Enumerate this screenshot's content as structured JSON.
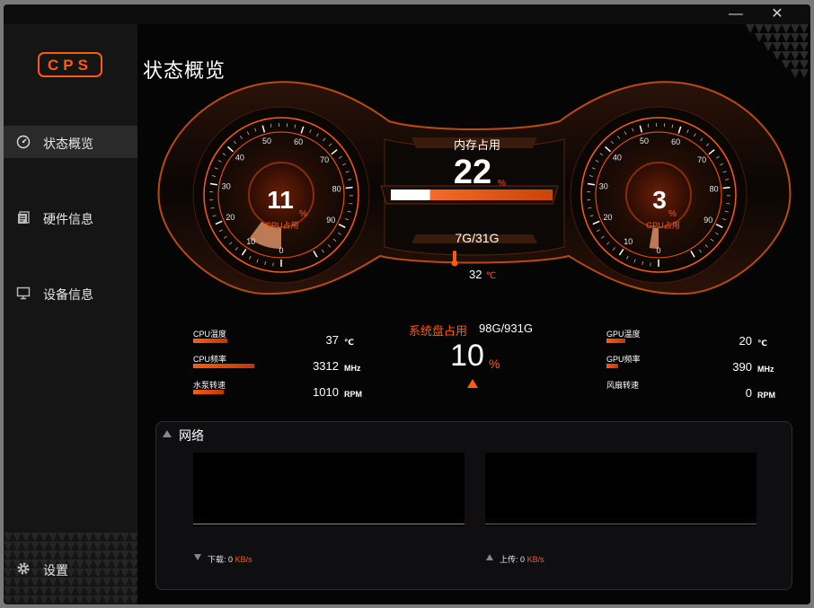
{
  "window": {
    "minimize_glyph": "—",
    "close_glyph": "✕"
  },
  "logo": {
    "text": "CPS"
  },
  "sidebar": {
    "items": [
      {
        "label": "状态概览",
        "icon": "gauge-icon"
      },
      {
        "label": "硬件信息",
        "icon": "document-icon"
      },
      {
        "label": "设备信息",
        "icon": "monitor-icon"
      }
    ],
    "settings_label": "设置"
  },
  "page_title": "状态概览",
  "cpu_gauge": {
    "value": "11",
    "unit": "%",
    "label": "CPU占用",
    "ticks": [
      "0",
      "10",
      "20",
      "30",
      "40",
      "50",
      "60",
      "70",
      "80",
      "90"
    ],
    "percent": 11
  },
  "gpu_gauge": {
    "value": "3",
    "unit": "%",
    "label": "GPU占用",
    "ticks": [
      "0",
      "10",
      "20",
      "30",
      "40",
      "50",
      "60",
      "70",
      "80",
      "90"
    ],
    "percent": 3
  },
  "memory": {
    "title": "内存占用",
    "value": "22",
    "unit": "%",
    "usage": "7G/31G",
    "percent": 22
  },
  "temperature": {
    "value": "32",
    "unit": "℃"
  },
  "cpu_stats": [
    {
      "label": "CPU温度",
      "value": "37",
      "unit": "℃",
      "level": 0.45
    },
    {
      "label": "CPU频率",
      "value": "3312",
      "unit": "MHz",
      "level": 0.8
    },
    {
      "label": "水泵转速",
      "value": "1010",
      "unit": "RPM",
      "level": 0.4
    }
  ],
  "gpu_stats": [
    {
      "label": "GPU温度",
      "value": "20",
      "unit": "℃",
      "level": 0.25
    },
    {
      "label": "GPU频率",
      "value": "390",
      "unit": "MHz",
      "level": 0.15
    },
    {
      "label": "风扇转速",
      "value": "0",
      "unit": "RPM",
      "level": 0
    }
  ],
  "disk": {
    "title": "系统盘占用",
    "usage": "98G/931G",
    "value": "10",
    "unit": "%"
  },
  "network": {
    "title": "网络",
    "download_label": "下载:",
    "download_value": "0",
    "upload_label": "上传:",
    "upload_value": "0",
    "rate_unit": "KB/s"
  },
  "colors": {
    "accent": "#ff5a10",
    "background": "#050505",
    "sidebar": "#151515"
  }
}
